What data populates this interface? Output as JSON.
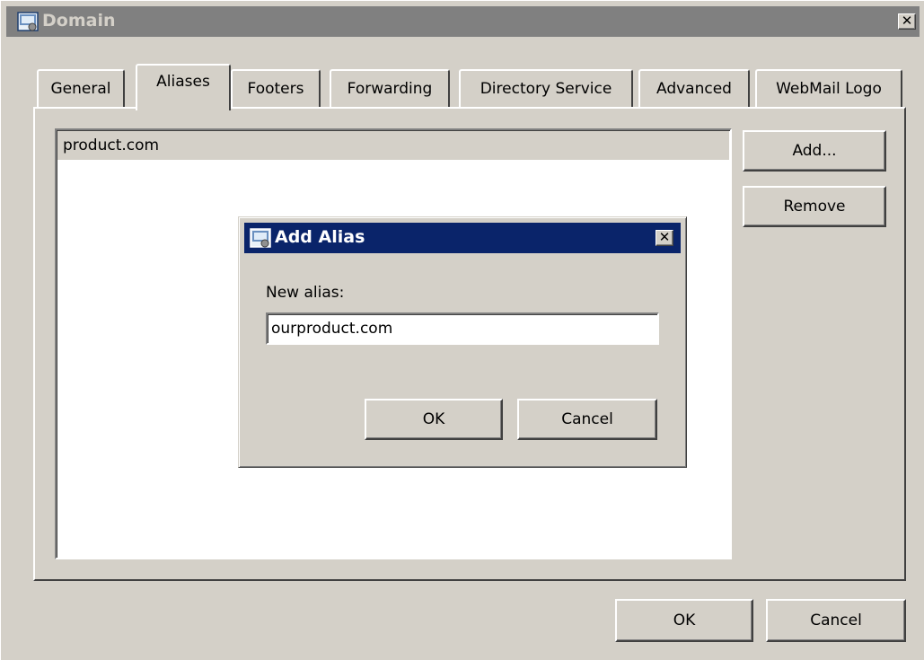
{
  "window": {
    "title": "Domain",
    "close_glyph": "✕",
    "icon": "domain-app-icon"
  },
  "tabs": [
    {
      "label": "General"
    },
    {
      "label": "Aliases"
    },
    {
      "label": "Footers"
    },
    {
      "label": "Forwarding"
    },
    {
      "label": "Directory Service"
    },
    {
      "label": "Advanced"
    },
    {
      "label": "WebMail Logo"
    }
  ],
  "active_tab": "Aliases",
  "aliases": {
    "items": [
      {
        "name": "product.com"
      }
    ],
    "add_label": "Add...",
    "remove_label": "Remove"
  },
  "dialog": {
    "title": "Add Alias",
    "close_glyph": "✕",
    "field_label": "New alias:",
    "field_value": "ourproduct.com",
    "ok_label": "OK",
    "cancel_label": "Cancel"
  },
  "footer": {
    "ok_label": "OK",
    "cancel_label": "Cancel"
  }
}
